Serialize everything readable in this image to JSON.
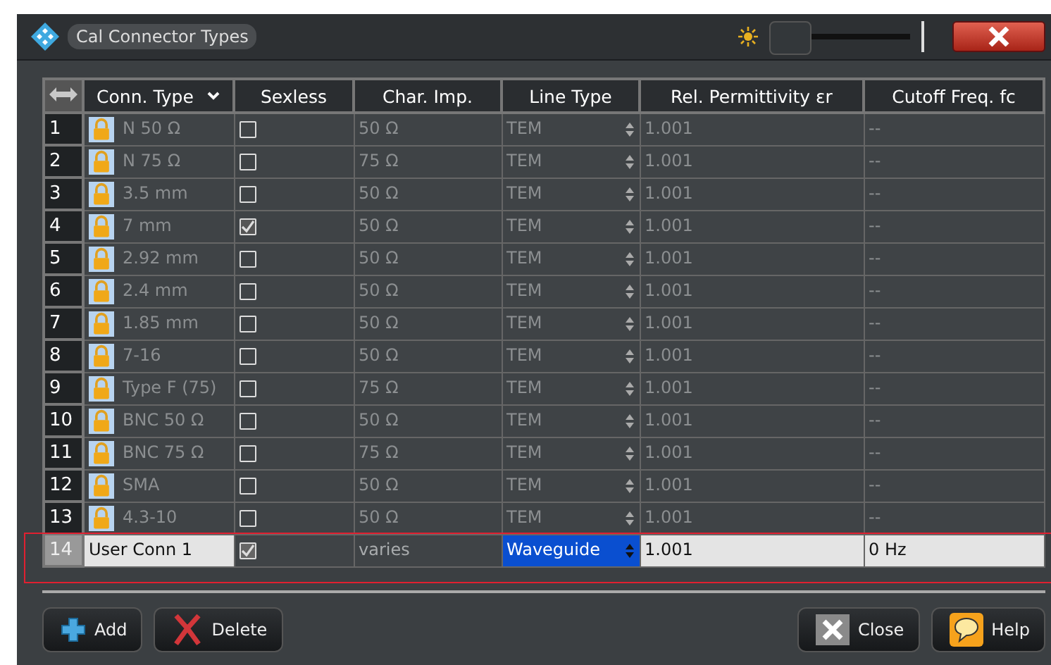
{
  "window": {
    "title": "Cal Connector Types"
  },
  "table": {
    "columns": [
      "Conn. Type",
      "Sexless",
      "Char. Imp.",
      "Line Type",
      "Rel. Permittivity εr",
      "Cutoff Freq. fc"
    ],
    "rows": [
      {
        "number": "1",
        "name": "N 50 Ω",
        "locked": true,
        "sexless": false,
        "impedance": "50 Ω",
        "line_type": "TEM",
        "permittivity": "1.001",
        "cutoff": "--",
        "selected": false
      },
      {
        "number": "2",
        "name": "N 75 Ω",
        "locked": true,
        "sexless": false,
        "impedance": "75 Ω",
        "line_type": "TEM",
        "permittivity": "1.001",
        "cutoff": "--",
        "selected": false
      },
      {
        "number": "3",
        "name": "3.5 mm",
        "locked": true,
        "sexless": false,
        "impedance": "50 Ω",
        "line_type": "TEM",
        "permittivity": "1.001",
        "cutoff": "--",
        "selected": false
      },
      {
        "number": "4",
        "name": "7 mm",
        "locked": true,
        "sexless": true,
        "impedance": "50 Ω",
        "line_type": "TEM",
        "permittivity": "1.001",
        "cutoff": "--",
        "selected": false
      },
      {
        "number": "5",
        "name": "2.92 mm",
        "locked": true,
        "sexless": false,
        "impedance": "50 Ω",
        "line_type": "TEM",
        "permittivity": "1.001",
        "cutoff": "--",
        "selected": false
      },
      {
        "number": "6",
        "name": "2.4 mm",
        "locked": true,
        "sexless": false,
        "impedance": "50 Ω",
        "line_type": "TEM",
        "permittivity": "1.001",
        "cutoff": "--",
        "selected": false
      },
      {
        "number": "7",
        "name": "1.85 mm",
        "locked": true,
        "sexless": false,
        "impedance": "50 Ω",
        "line_type": "TEM",
        "permittivity": "1.001",
        "cutoff": "--",
        "selected": false
      },
      {
        "number": "8",
        "name": "7-16",
        "locked": true,
        "sexless": false,
        "impedance": "50 Ω",
        "line_type": "TEM",
        "permittivity": "1.001",
        "cutoff": "--",
        "selected": false
      },
      {
        "number": "9",
        "name": "Type F (75)",
        "locked": true,
        "sexless": false,
        "impedance": "75 Ω",
        "line_type": "TEM",
        "permittivity": "1.001",
        "cutoff": "--",
        "selected": false
      },
      {
        "number": "10",
        "name": "BNC 50 Ω",
        "locked": true,
        "sexless": false,
        "impedance": "50 Ω",
        "line_type": "TEM",
        "permittivity": "1.001",
        "cutoff": "--",
        "selected": false
      },
      {
        "number": "11",
        "name": "BNC 75 Ω",
        "locked": true,
        "sexless": false,
        "impedance": "75 Ω",
        "line_type": "TEM",
        "permittivity": "1.001",
        "cutoff": "--",
        "selected": false
      },
      {
        "number": "12",
        "name": "SMA",
        "locked": true,
        "sexless": false,
        "impedance": "50 Ω",
        "line_type": "TEM",
        "permittivity": "1.001",
        "cutoff": "--",
        "selected": false
      },
      {
        "number": "13",
        "name": "4.3-10",
        "locked": true,
        "sexless": false,
        "impedance": "50 Ω",
        "line_type": "TEM",
        "permittivity": "1.001",
        "cutoff": "--",
        "selected": false
      },
      {
        "number": "14",
        "name": "User Conn 1",
        "locked": false,
        "sexless": true,
        "impedance": "varies",
        "line_type": "Waveguide",
        "permittivity": "1.001",
        "cutoff": "0 Hz",
        "selected": true
      }
    ]
  },
  "buttons": [
    {
      "kind": "add",
      "label": "Add"
    },
    {
      "kind": "delete",
      "label": "Delete"
    },
    {
      "kind": "close",
      "label": "Close"
    },
    {
      "kind": "help",
      "label": "Help"
    }
  ]
}
